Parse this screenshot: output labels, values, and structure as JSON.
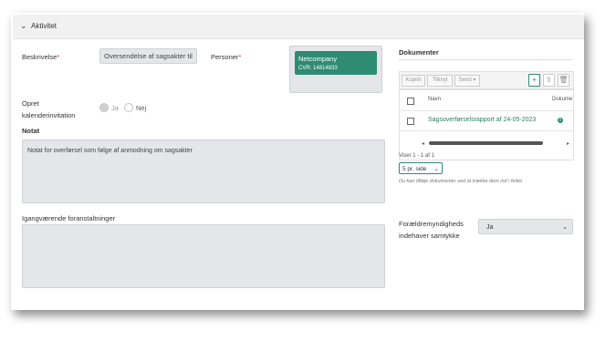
{
  "header": {
    "title": "Aktivitet"
  },
  "form": {
    "beskrivelse_label": "Beskrivelse",
    "required_mark": "*",
    "beskrivelse_value": "Oversendelse af sagsakter til",
    "personer_label": "Personer",
    "person": {
      "name": "Netcompany",
      "cvr": "CVR: 14814833"
    },
    "opret_label_1": "Opret",
    "opret_label_2": "kalenderinvitation",
    "radio_ja": "Ja",
    "radio_nej": "Nej",
    "notat_label": "Notat",
    "notat_value": "Notat for overførsel som følge af anmodning om sagsakter",
    "igang_label": "Igangværende foranstaltninger",
    "foraeldre_label_1": "Forældremyndigheds",
    "foraeldre_label_2": "indehaver samtykke",
    "foraeldre_value": "Ja"
  },
  "documents": {
    "title": "Dokumenter",
    "toolbar": {
      "kopier": "Kopiér",
      "tilknyt": "Tilknyt",
      "send": "Send ▾"
    },
    "columns": [
      "Navn",
      "Dokume"
    ],
    "rows": [
      {
        "name": "Sagsoverførselsrapport af 24-05-2023"
      }
    ],
    "viser": "Viser 1 - 1 af 1",
    "page_size": "5 pr. side",
    "hint": "Du kan tilføje dokumenter ved at trække dem ind i feltet."
  },
  "icons": {
    "chevron": "chevron-down-icon",
    "add": "plus-icon",
    "upload": "upload-icon",
    "delete": "trash-icon",
    "info": "info-icon"
  },
  "colors": {
    "accent": "#2e8b74",
    "required": "#c0392b"
  }
}
